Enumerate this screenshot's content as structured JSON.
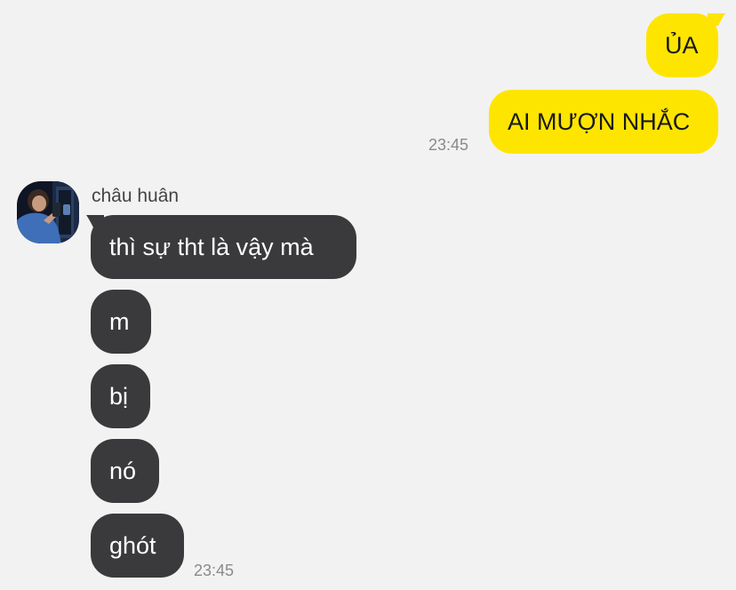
{
  "outgoing": {
    "messages": [
      {
        "text": "ỦA"
      },
      {
        "text": "AI MƯỢN NHẮC"
      }
    ],
    "time": "23:45",
    "bubble_color": "#fee500"
  },
  "incoming": {
    "sender_name": "châu huân",
    "avatar_icon": "profile-photo-avatar",
    "messages": [
      {
        "text": "thì sự tht là vậy mà"
      },
      {
        "text": "m"
      },
      {
        "text": "bị"
      },
      {
        "text": "nó"
      },
      {
        "text": "ghót"
      }
    ],
    "time": "23:45",
    "bubble_color": "#3a3a3c"
  },
  "background_color": "#f2f2f2"
}
